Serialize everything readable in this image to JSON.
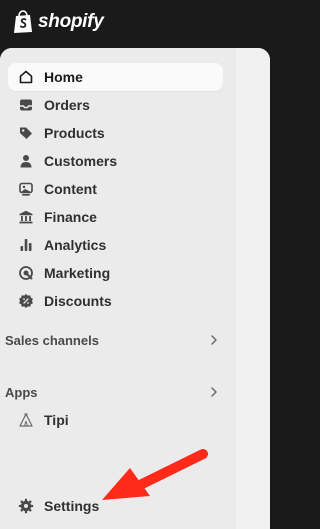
{
  "brand": {
    "name": "shopify",
    "color": "#ffffff",
    "icon": "shopify-bag-icon"
  },
  "nav": [
    {
      "label": "Home",
      "icon": "home-icon",
      "active": true
    },
    {
      "label": "Orders",
      "icon": "inbox-icon",
      "active": false
    },
    {
      "label": "Products",
      "icon": "tag-icon",
      "active": false
    },
    {
      "label": "Customers",
      "icon": "person-icon",
      "active": false
    },
    {
      "label": "Content",
      "icon": "content-icon",
      "active": false
    },
    {
      "label": "Finance",
      "icon": "bank-icon",
      "active": false
    },
    {
      "label": "Analytics",
      "icon": "bar-chart-icon",
      "active": false
    },
    {
      "label": "Marketing",
      "icon": "target-icon",
      "active": false
    },
    {
      "label": "Discounts",
      "icon": "discount-icon",
      "active": false
    }
  ],
  "sections": {
    "sales_channels": {
      "label": "Sales channels"
    },
    "apps": {
      "label": "Apps",
      "items": [
        {
          "label": "Tipi",
          "icon": "tipi-icon"
        }
      ]
    }
  },
  "settings": {
    "label": "Settings",
    "icon": "gear-icon"
  },
  "annotation": {
    "icon": "red-arrow-icon",
    "color": "#ff2a1a"
  }
}
